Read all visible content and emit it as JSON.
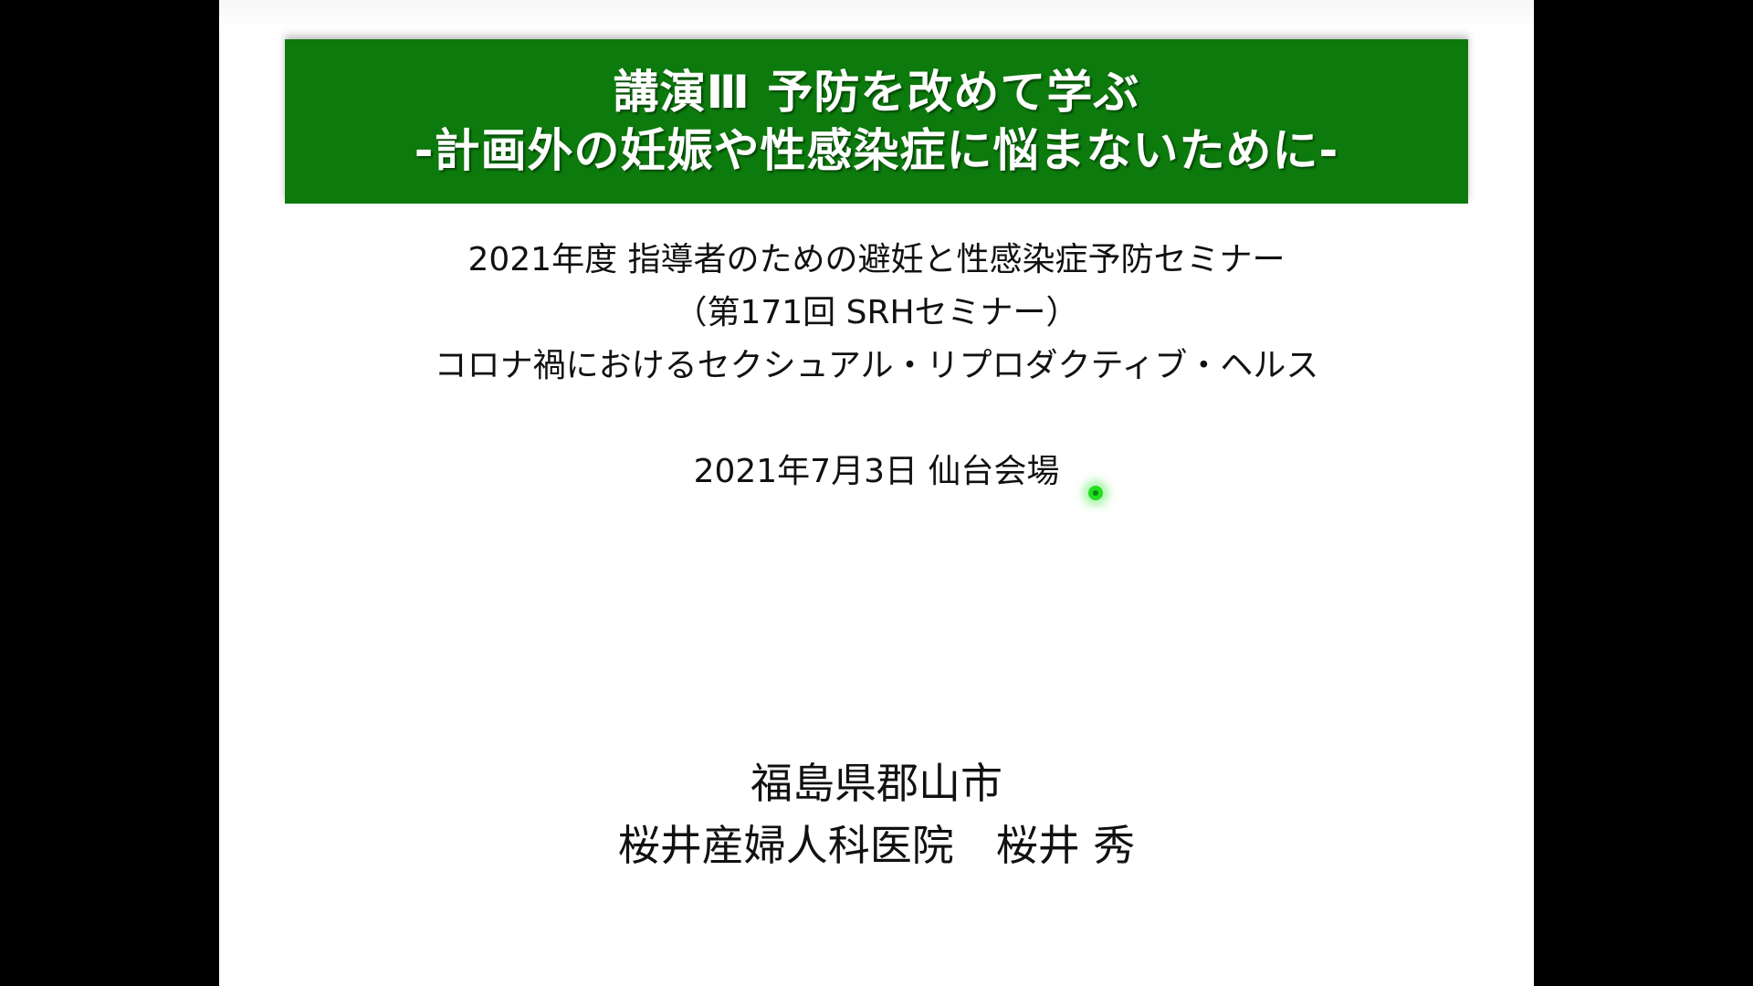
{
  "colors": {
    "letterbox": "#000000",
    "slide_background": "#ffffff",
    "banner_background": "#0c7a0c",
    "banner_text": "#ffffff",
    "body_text": "#111111",
    "pointer": "#22dd22"
  },
  "slide": {
    "title": {
      "line1": "講演Ⅲ 予防を改めて学ぶ",
      "line2": "-計画外の妊娠や性感染症に悩まないために-"
    },
    "subtitle": {
      "line1": "2021年度 指導者のための避妊と性感染症予防セミナー",
      "line2": "（第171回 SRHセミナー）",
      "line3": "コロナ禍におけるセクシュアル・リプロダクティブ・ヘルス"
    },
    "date_venue": "2021年7月3日 仙台会場",
    "presenter": {
      "location": "福島県郡山市",
      "affiliation_name": "桜井産婦人科医院　桜井 秀"
    }
  },
  "pointer_icon": "laser-pointer-dot"
}
